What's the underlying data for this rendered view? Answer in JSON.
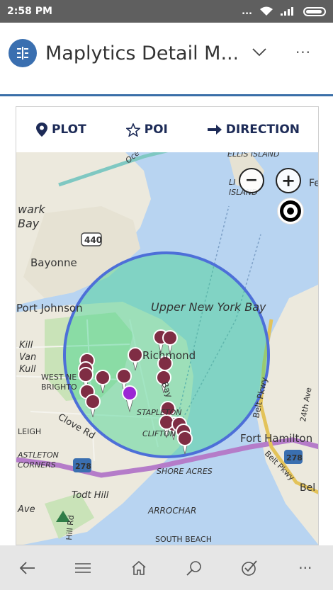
{
  "status": {
    "time": "2:58 PM",
    "signal": "...",
    "carrier_bars": ".ıll"
  },
  "header": {
    "title": "Maplytics Detail M...",
    "app_icon": "maplytics-logo-icon",
    "chevron_icon": "chevron-down-icon",
    "more_icon": "more-icon",
    "more_label": "···"
  },
  "toolbar": {
    "plot_label": "PLOT",
    "poi_label": "POI",
    "direction_label": "DIRECTION",
    "plot_icon": "map-pin-icon",
    "poi_icon": "star-icon",
    "direction_icon": "arrow-right-icon"
  },
  "map": {
    "zoom_in_label": "+",
    "zoom_out_label": "−",
    "locate_icon": "locate-icon",
    "circle_color": "#3fd38e",
    "circle_border": "#4d6fd8",
    "pin_color": "#7f2d44",
    "selected_pin_color": "#9b27d4",
    "labels": {
      "ellis_island": "ELLIS ISLAND",
      "liberty_island_l": "LI",
      "island": "ISLAND",
      "fe": "Fe",
      "newark_bay_1": "wark",
      "newark_bay_2": "Bay",
      "route_440": "440",
      "bayonne": "Bayonne",
      "port_johnson": "Port Johnson",
      "upper_ny_bay": "Upper New York Bay",
      "richmond": "Richmond",
      "kill_1": "Kill",
      "kill_2": "Van",
      "kill_3": "Kull",
      "west_brighton_1": "WEST NE",
      "west_brighton_2": "BRIGHTO",
      "bay_st": "Bay",
      "clove_rd": "Clove Rd",
      "stapleton": "STAPLETON",
      "clifton": "CLIFTON",
      "leigh": "LEIGH",
      "castleton_1": "ASTLETON",
      "castleton_2": "CORNERS",
      "route_278_a": "278",
      "route_278_b": "278",
      "shore_acres": "SHORE ACRES",
      "fort_hamilton": "Fort Hamilton",
      "belt_pkwy_1": "Belt Pkwy",
      "belt_pkwy_2": "Belt Pkwy",
      "belt_3": "Bel",
      "ave_24": "24th Ave",
      "todt_hill": "Todt Hill",
      "ave": "Ave",
      "arrochar": "ARROCHAR",
      "south_beach": "SOUTH BEACH",
      "hill_rd": "Hill Rd",
      "ocean": "Oce"
    }
  },
  "bottom_nav": {
    "back_icon": "back-arrow-icon",
    "menu_icon": "hamburger-menu-icon",
    "home_icon": "home-icon",
    "search_icon": "search-icon",
    "check_icon": "check-circle-icon",
    "more_icon": "more-icon",
    "more_label": "···"
  }
}
